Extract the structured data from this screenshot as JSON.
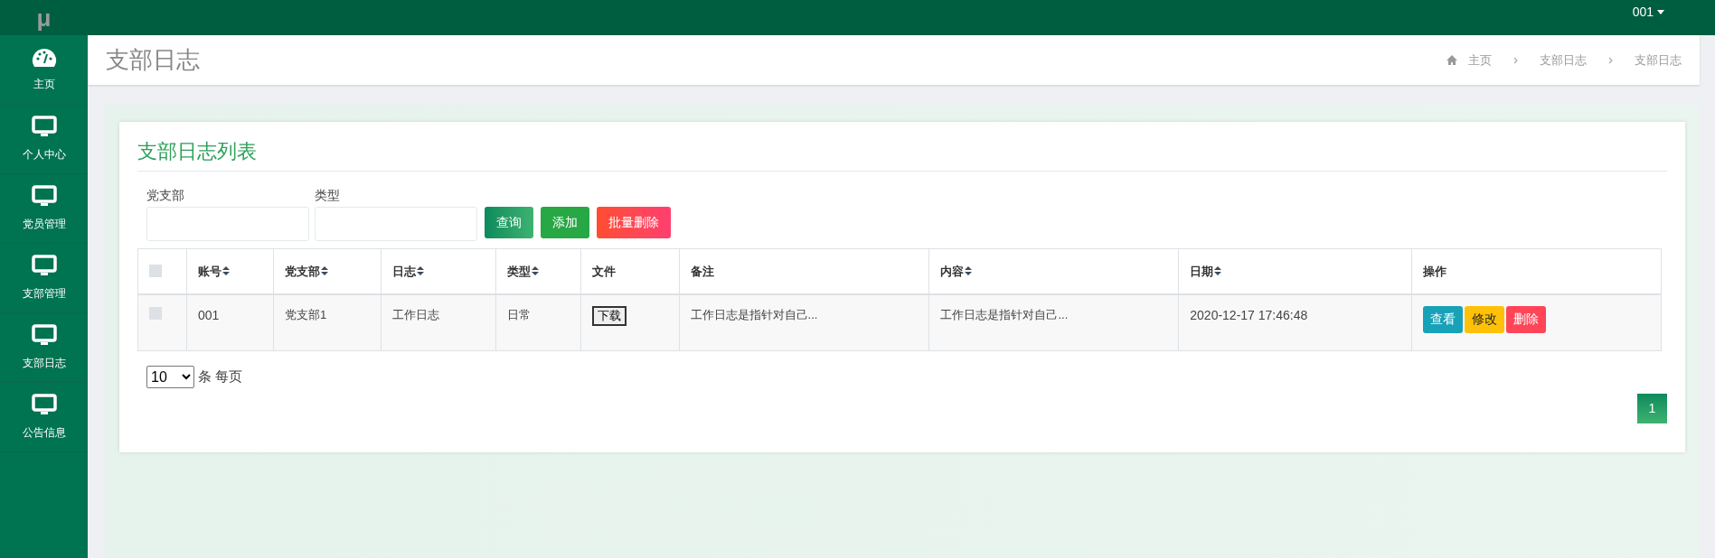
{
  "logo": "μ",
  "user_menu": {
    "label": "001"
  },
  "sidebar": {
    "items": [
      {
        "label": "主页",
        "kind": "dashboard",
        "selected": false
      },
      {
        "label": "个人中心",
        "kind": "module",
        "selected": false
      },
      {
        "label": "党员管理",
        "kind": "module",
        "selected": false
      },
      {
        "label": "支部管理",
        "kind": "module",
        "selected": false
      },
      {
        "label": "支部日志",
        "kind": "module",
        "selected": false
      },
      {
        "label": "公告信息",
        "kind": "module",
        "selected": false
      }
    ]
  },
  "page_title": "支部日志",
  "breadcrumb": [
    "主页",
    "支部日志",
    "支部日志"
  ],
  "card": {
    "title": "支部日志列表",
    "filters": [
      {
        "label": "党支部"
      },
      {
        "label": "类型"
      }
    ],
    "buttons": [
      {
        "label": "查询",
        "kind": "search"
      },
      {
        "label": "添加",
        "kind": "add"
      },
      {
        "label": "批量删除",
        "kind": "delete"
      }
    ],
    "table": {
      "select_all_checked": false,
      "columns": [
        {
          "label": "账号",
          "sortable": true
        },
        {
          "label": "党支部",
          "sortable": true
        },
        {
          "label": "日志",
          "sortable": true
        },
        {
          "label": "类型",
          "sortable": true
        },
        {
          "label": "文件",
          "sortable": false
        },
        {
          "label": "备注",
          "sortable": false
        },
        {
          "label": "内容",
          "sortable": true
        },
        {
          "label": "日期",
          "sortable": true
        },
        {
          "label": "操作",
          "sortable": false
        }
      ],
      "rows": [
        {
          "checked": false,
          "account": "001",
          "branch": "党支部1",
          "log": "工作日志",
          "type": "日常",
          "file_button": "下载",
          "note": "工作日志是指针对自己...",
          "content": "工作日志是指针对自己...",
          "date": "2020-12-17 17:46:48",
          "actions": [
            {
              "label": "查看",
              "kind": "view"
            },
            {
              "label": "修改",
              "kind": "edit"
            },
            {
              "label": "删除",
              "kind": "delete"
            }
          ]
        }
      ]
    },
    "page_size": {
      "value": "10",
      "suffix": "条 每页"
    },
    "pagination": [
      {
        "label": "1",
        "selected": true
      }
    ]
  }
}
